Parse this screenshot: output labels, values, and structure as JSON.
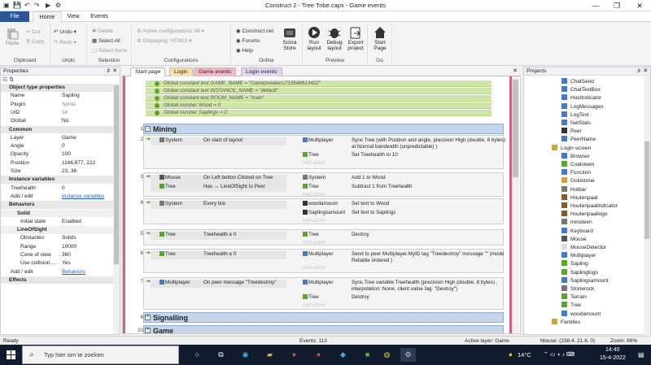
{
  "window": {
    "title": "Construct 2 - Tree Tribe.capx - Game events"
  },
  "ribbon_tabs": [
    "File",
    "Home",
    "View",
    "Events"
  ],
  "ribbon": {
    "clipboard": {
      "paste": "Paste",
      "cut": "Cut",
      "copy": "Copy",
      "label": "Clipboard"
    },
    "undo": {
      "undo": "Undo",
      "redo": "Redo",
      "label": "Undo"
    },
    "selection": {
      "delete": "Delete",
      "select_all": "Select All",
      "select_none": "Select None",
      "label": "Selection"
    },
    "configurations": {
      "active": "Active configurations: All",
      "displaying": "Displaying:  HTML5",
      "label": "Configurations"
    },
    "online": {
      "construct_net": "Construct.net",
      "forums": "Forums",
      "help": "Help",
      "scirra_store_1": "Scirra",
      "scirra_store_2": "Store",
      "label": "Online"
    },
    "preview": {
      "run_1": "Run",
      "run_2": "layout",
      "debug_1": "Debug",
      "debug_2": "layout",
      "export_1": "Export",
      "export_2": "project",
      "label": "Preview"
    },
    "go": {
      "start_1": "Start",
      "start_2": "Page",
      "label": "Go"
    }
  },
  "properties_panel": {
    "title": "Properties",
    "rows": [
      {
        "type": "sec",
        "k": "Object type properties"
      },
      {
        "k": "Name",
        "v": "Sapling"
      },
      {
        "k": "Plugin",
        "v": "Sprite",
        "muted": true
      },
      {
        "k": "UID",
        "v": "34",
        "muted": true
      },
      {
        "k": "Global",
        "v": "No"
      },
      {
        "type": "sec",
        "k": "Common"
      },
      {
        "k": "Layer",
        "v": "Game"
      },
      {
        "k": "Angle",
        "v": "0"
      },
      {
        "k": "Opacity",
        "v": "100"
      },
      {
        "k": "Position",
        "v": "1166.677, 222"
      },
      {
        "k": "Size",
        "v": "23, 36"
      },
      {
        "type": "sec",
        "k": "Instance variables"
      },
      {
        "k": "Treehealth",
        "v": "0"
      },
      {
        "k": "Add / edit",
        "v": "Instance variables",
        "link": true
      },
      {
        "type": "sec",
        "k": "Behaviors"
      },
      {
        "type": "sub-sec",
        "k": "Solid"
      },
      {
        "k": "Initial state",
        "v": "Enabled",
        "sub": true
      },
      {
        "type": "sub-sec",
        "k": "LineOfSight"
      },
      {
        "k": "Obstacles",
        "v": "Solids",
        "sub": true
      },
      {
        "k": "Range",
        "v": "10000",
        "sub": true
      },
      {
        "k": "Cone of view",
        "v": "360",
        "sub": true
      },
      {
        "k": "Use collision ...",
        "v": "Yes",
        "sub": true
      },
      {
        "k": "Add / edit",
        "v": "Behaviors",
        "link": true
      },
      {
        "type": "sec",
        "k": "Effects"
      }
    ]
  },
  "sheet_tabs": [
    "Start page",
    "Login",
    "Game events",
    "Login events"
  ],
  "globals": [
    "Global constant text  GAME_NAME = \"Gamebreakers713548913422\"",
    "Global constant text  INSTANCE_NAME = \"default\"",
    "Global constant text  ROOM_NAME = \"main\"",
    "Global number  Wood = 0",
    "Global number  Saplings = 0"
  ],
  "groups": [
    {
      "num": "1",
      "name": "Mining",
      "toggle": "–"
    },
    {
      "num": "8",
      "name": "Signalling",
      "toggle": "+"
    },
    {
      "num": "20",
      "name": "Game",
      "toggle": "+"
    }
  ],
  "events": [
    {
      "num": "2",
      "conds": [
        {
          "obj": "System",
          "text": "On start of layout"
        }
      ],
      "actions": [
        {
          "obj": "Multiplayer",
          "text": "Sync  Tree (with Position and angle, precision High (double, 8 bytes) at Normal bandwidth (unpredictable) )"
        },
        {
          "obj": "Tree",
          "text": "Set Treehealth to 10"
        }
      ]
    },
    {
      "num": "3",
      "conds": [
        {
          "obj": "Mouse",
          "text": "On Left button Clicked on Tree"
        },
        {
          "obj": "Tree",
          "text": "Has ↔ LineOfSight to  Peer"
        }
      ],
      "actions": [
        {
          "obj": "System",
          "text": "Add 1 to Wood"
        },
        {
          "obj": "Tree",
          "text": "Subtract 1 from Treehealth"
        }
      ]
    },
    {
      "num": "4",
      "conds": [
        {
          "obj": "System",
          "text": "Every tick"
        }
      ],
      "actions": [
        {
          "obj": "woodamount",
          "text": "Set text to Wood"
        },
        {
          "obj": "Saplingsamount",
          "text": "Set text to Saplings"
        }
      ]
    },
    {
      "num": "5",
      "conds": [
        {
          "obj": "Tree",
          "text": "Treehealth ≤ 0"
        }
      ],
      "actions": [
        {
          "obj": "Tree",
          "text": "Destroy"
        }
      ]
    },
    {
      "num": "6",
      "conds": [
        {
          "obj": "Tree",
          "text": "Treehealth ≤ 0"
        }
      ],
      "actions": [
        {
          "obj": "Multiplayer",
          "text": "Send to peer Multiplayer.MyID  tag \"Treedestroy\" message \"\" (mode Reliable ordered )"
        }
      ]
    },
    {
      "num": "7",
      "conds": [
        {
          "obj": "Multiplayer",
          "text": "On peer message \"Treedestroy\""
        }
      ],
      "actions": [
        {
          "obj": "Multiplayer",
          "text": "Sync  Tree variable Treehealth (precision High (double, 8 bytes) , interpolation: None, client value tag: \"Destroy\")"
        },
        {
          "obj": "Tree",
          "text": "Destroy"
        }
      ]
    }
  ],
  "add_action": "Add action",
  "projects_panel": {
    "title": "Projects",
    "items": [
      "ChatSend",
      "ChatTextBox",
      "HostIndicator",
      "LogMessages",
      "LogText",
      "NetStats",
      "Peer",
      "PeerName",
      "Login screen",
      "Browser",
      "Coalsteen",
      "Function",
      "Goldstone",
      "Hotbar",
      "Houtenpaal",
      "Houtenpaalindicator",
      "Houtenpaallogo",
      "ironsteen",
      "Keyboard",
      "Mouse",
      "MouseDetector",
      "Multiplayer",
      "Sapling",
      "Saplinglogo",
      "Saplingsamount",
      "Stonerock",
      "Terrain",
      "Tree",
      "woodamount",
      "Families"
    ]
  },
  "status": {
    "ready": "Ready",
    "events": "Events: 113",
    "layer": "Active layer: Game",
    "mouse": "Mouse: (238.4, 21.6, 0)",
    "zoom": "Zoom: 66%"
  },
  "taskbar": {
    "search_placeholder": "Typ hier om te zoeken",
    "temp": "14°C",
    "time": "14:40",
    "date": "15-4-2022"
  },
  "colors": {
    "accent": "#2b579a",
    "group": "#c5d5ea",
    "global_row": "#cfe6a8",
    "active_tab": "#e05a86"
  }
}
